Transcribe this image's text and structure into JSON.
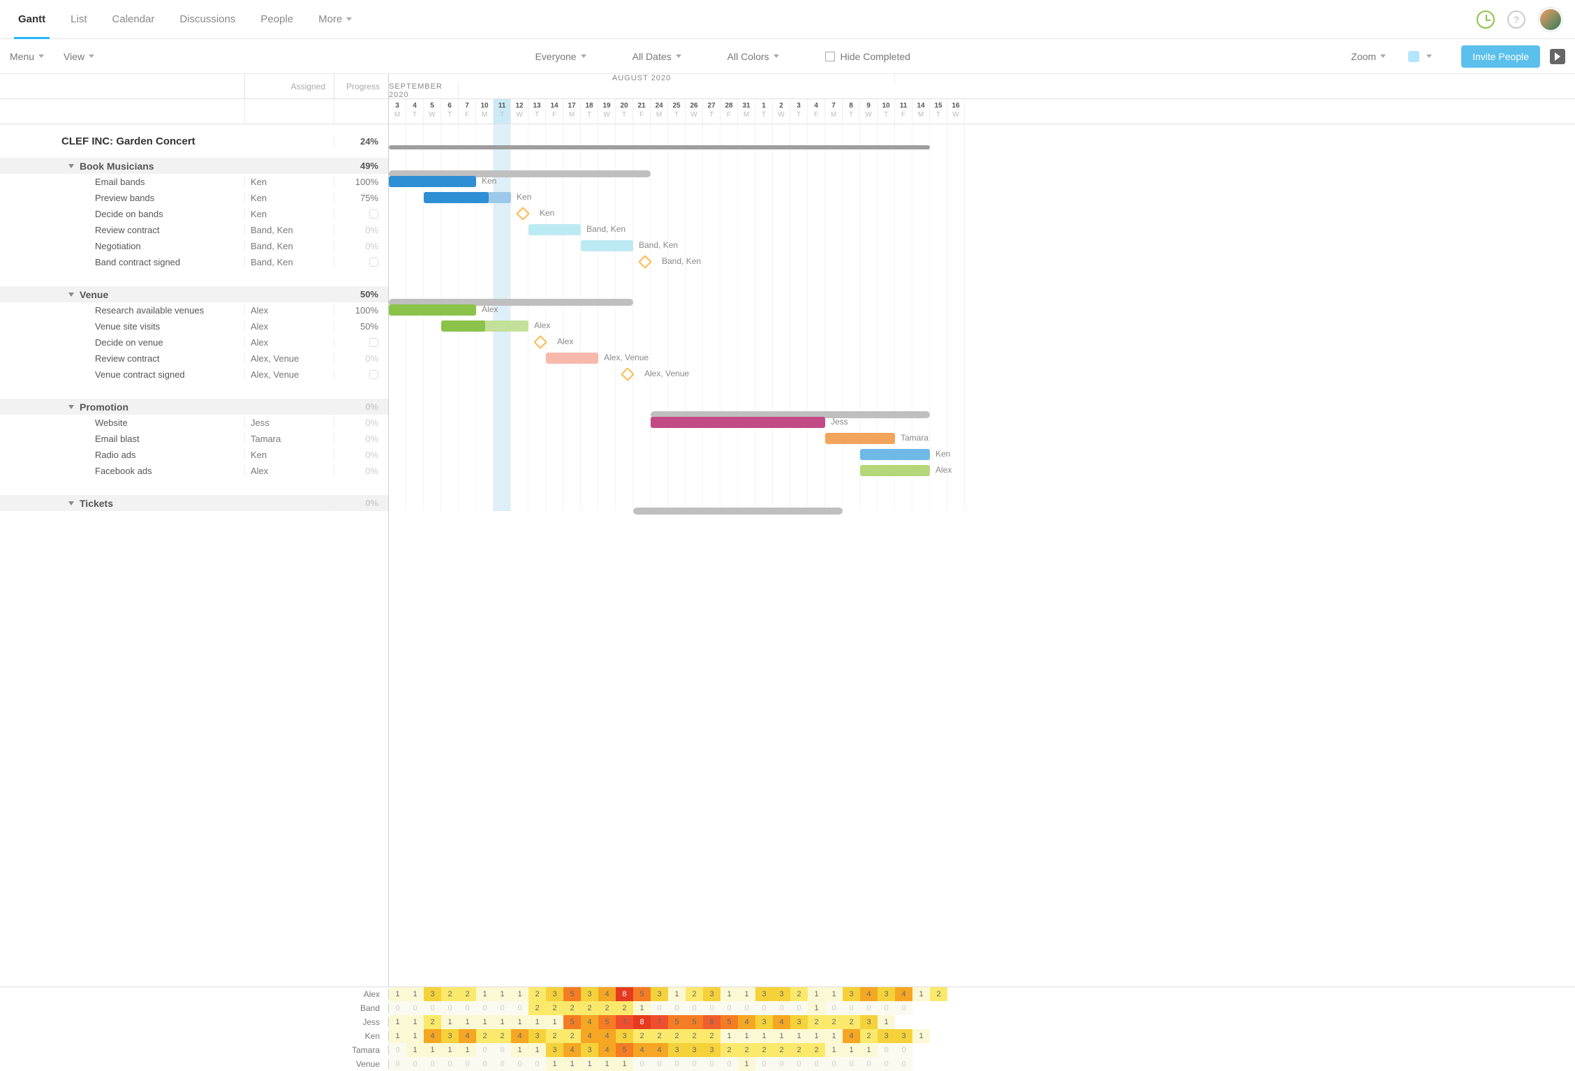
{
  "nav": {
    "tabs": [
      "Gantt",
      "List",
      "Calendar",
      "Discussions",
      "People",
      "More"
    ],
    "active": 0
  },
  "toolbar": {
    "menu": "Menu",
    "view": "View",
    "everyone": "Everyone",
    "all_dates": "All Dates",
    "all_colors": "All Colors",
    "hide_completed": "Hide Completed",
    "zoom": "Zoom",
    "invite": "Invite People"
  },
  "columns": {
    "assigned": "Assigned",
    "progress": "Progress"
  },
  "timeline": {
    "months": [
      {
        "label": "AUGUST 2020",
        "days": 29
      },
      {
        "label": "SEPTEMBER 2020",
        "days": 4
      }
    ],
    "days": [
      {
        "n": "3",
        "w": "M"
      },
      {
        "n": "4",
        "w": "T"
      },
      {
        "n": "5",
        "w": "W"
      },
      {
        "n": "6",
        "w": "T"
      },
      {
        "n": "7",
        "w": "F"
      },
      {
        "n": "10",
        "w": "M"
      },
      {
        "n": "11",
        "w": "T",
        "today": true
      },
      {
        "n": "12",
        "w": "W"
      },
      {
        "n": "13",
        "w": "T"
      },
      {
        "n": "14",
        "w": "F"
      },
      {
        "n": "17",
        "w": "M"
      },
      {
        "n": "18",
        "w": "T"
      },
      {
        "n": "19",
        "w": "W"
      },
      {
        "n": "20",
        "w": "T"
      },
      {
        "n": "21",
        "w": "F"
      },
      {
        "n": "24",
        "w": "M"
      },
      {
        "n": "25",
        "w": "T"
      },
      {
        "n": "26",
        "w": "W"
      },
      {
        "n": "27",
        "w": "T"
      },
      {
        "n": "28",
        "w": "F"
      },
      {
        "n": "31",
        "w": "M"
      },
      {
        "n": "1",
        "w": "T"
      },
      {
        "n": "2",
        "w": "W"
      },
      {
        "n": "3",
        "w": "T"
      },
      {
        "n": "4",
        "w": "F"
      },
      {
        "n": "7",
        "w": "M"
      },
      {
        "n": "8",
        "w": "T"
      },
      {
        "n": "9",
        "w": "W"
      },
      {
        "n": "10",
        "w": "T"
      },
      {
        "n": "11",
        "w": "F"
      },
      {
        "n": "14",
        "w": "M"
      },
      {
        "n": "15",
        "w": "T"
      },
      {
        "n": "16",
        "w": "W"
      }
    ],
    "today_index": 6
  },
  "project": {
    "title": "CLEF INC: Garden Concert",
    "progress": "24%",
    "groups": [
      {
        "name": "Book Musicians",
        "progress": "49%",
        "summary": {
          "start": 0,
          "span": 15
        },
        "tasks": [
          {
            "name": "Email bands",
            "assigned": "Ken",
            "progress": "100%",
            "bar": {
              "start": 0,
              "span": 5,
              "color": "#2f8fd4"
            },
            "label": "Ken"
          },
          {
            "name": "Preview bands",
            "assigned": "Ken",
            "progress": "75%",
            "bar": {
              "start": 2,
              "span": 5,
              "color": "#2f8fd4",
              "partial": 3.7,
              "pale": "#9cc9ea"
            },
            "label": "Ken"
          },
          {
            "name": "Decide on bands",
            "assigned": "Ken",
            "progress": "",
            "box": true,
            "diamond": {
              "at": 7.4
            },
            "label": "Ken"
          },
          {
            "name": "Review contract",
            "assigned": "Band, Ken",
            "progress": "0%",
            "zero": true,
            "bar": {
              "start": 8,
              "span": 3,
              "color": "#bceaf2"
            },
            "label": "Band, Ken"
          },
          {
            "name": "Negotiation",
            "assigned": "Band, Ken",
            "progress": "0%",
            "zero": true,
            "bar": {
              "start": 11,
              "span": 3,
              "color": "#bceaf2"
            },
            "label": "Band, Ken"
          },
          {
            "name": "Band contract signed",
            "assigned": "Band, Ken",
            "progress": "",
            "box": true,
            "diamond": {
              "at": 14.4
            },
            "label": "Band, Ken"
          }
        ]
      },
      {
        "spacer": true
      },
      {
        "name": "Venue",
        "progress": "50%",
        "summary": {
          "start": 0,
          "span": 14
        },
        "tasks": [
          {
            "name": "Research available venues",
            "assigned": "Alex",
            "progress": "100%",
            "bar": {
              "start": 0,
              "span": 5,
              "color": "#8bc34a"
            },
            "label": "Alex"
          },
          {
            "name": "Venue site visits",
            "assigned": "Alex",
            "progress": "50%",
            "bar": {
              "start": 3,
              "span": 5,
              "color": "#8bc34a",
              "partial": 2.5,
              "pale": "#c3e09b"
            },
            "label": "Alex"
          },
          {
            "name": "Decide on venue",
            "assigned": "Alex",
            "progress": "",
            "box": true,
            "diamond": {
              "at": 8.4
            },
            "label": "Alex"
          },
          {
            "name": "Review contract",
            "assigned": "Alex, Venue",
            "progress": "0%",
            "zero": true,
            "bar": {
              "start": 9,
              "span": 3,
              "color": "#f6b9ab"
            },
            "label": "Alex, Venue"
          },
          {
            "name": "Venue contract signed",
            "assigned": "Alex, Venue",
            "progress": "",
            "box": true,
            "diamond": {
              "at": 13.4
            },
            "label": "Alex, Venue"
          }
        ]
      },
      {
        "spacer": true
      },
      {
        "name": "Promotion",
        "progress": "0%",
        "zero": true,
        "summary": {
          "start": 15,
          "span": 16
        },
        "tasks": [
          {
            "name": "Website",
            "assigned": "Jess",
            "progress": "0%",
            "zero": true,
            "bar": {
              "start": 15,
              "span": 10,
              "color": "#c24a85"
            },
            "label": "Jess"
          },
          {
            "name": "Email blast",
            "assigned": "Tamara",
            "progress": "0%",
            "zero": true,
            "bar": {
              "start": 25,
              "span": 4,
              "color": "#f2a45b"
            },
            "label": "Tamara"
          },
          {
            "name": "Radio ads",
            "assigned": "Ken",
            "progress": "0%",
            "zero": true,
            "bar": {
              "start": 27,
              "span": 4,
              "color": "#6fb9e6"
            },
            "label": "Ken"
          },
          {
            "name": "Facebook ads",
            "assigned": "Alex",
            "progress": "0%",
            "zero": true,
            "bar": {
              "start": 27,
              "span": 4,
              "color": "#b5d77a"
            },
            "label": "Alex"
          }
        ]
      },
      {
        "spacer": true
      },
      {
        "name": "Tickets",
        "progress": "0%",
        "zero": true,
        "summary": {
          "start": 14,
          "span": 12
        },
        "tasks": []
      }
    ]
  },
  "workload": {
    "people": [
      "Alex",
      "Band",
      "Jess",
      "Ken",
      "Tamara",
      "Venue"
    ],
    "grid": [
      [
        1,
        1,
        3,
        2,
        2,
        1,
        1,
        1,
        2,
        3,
        5,
        3,
        4,
        8,
        5,
        3,
        1,
        2,
        3,
        1,
        1,
        3,
        3,
        2,
        1,
        1,
        3,
        4,
        3,
        4,
        1,
        2,
        ""
      ],
      [
        0,
        0,
        0,
        0,
        0,
        0,
        0,
        0,
        2,
        2,
        2,
        2,
        2,
        2,
        1,
        0,
        0,
        0,
        0,
        0,
        0,
        0,
        0,
        0,
        1,
        0,
        0,
        0,
        0,
        0,
        "",
        "",
        ""
      ],
      [
        1,
        1,
        2,
        1,
        1,
        1,
        1,
        1,
        1,
        1,
        5,
        4,
        5,
        7,
        8,
        7,
        5,
        5,
        6,
        5,
        4,
        3,
        4,
        3,
        2,
        2,
        2,
        3,
        1,
        "",
        "",
        "",
        ""
      ],
      [
        1,
        1,
        4,
        3,
        4,
        2,
        2,
        4,
        3,
        2,
        2,
        4,
        4,
        3,
        2,
        2,
        2,
        2,
        2,
        1,
        1,
        1,
        1,
        1,
        1,
        1,
        4,
        2,
        3,
        3,
        1,
        "",
        ""
      ],
      [
        0,
        1,
        1,
        1,
        1,
        0,
        0,
        1,
        1,
        3,
        4,
        3,
        4,
        5,
        4,
        4,
        3,
        3,
        3,
        2,
        2,
        2,
        2,
        2,
        2,
        1,
        1,
        1,
        0,
        0,
        "",
        "",
        ""
      ],
      [
        0,
        0,
        0,
        0,
        0,
        0,
        0,
        0,
        0,
        1,
        1,
        1,
        1,
        1,
        0,
        0,
        0,
        0,
        0,
        0,
        1,
        0,
        0,
        0,
        0,
        0,
        0,
        0,
        0,
        0,
        "",
        "",
        ""
      ]
    ]
  }
}
